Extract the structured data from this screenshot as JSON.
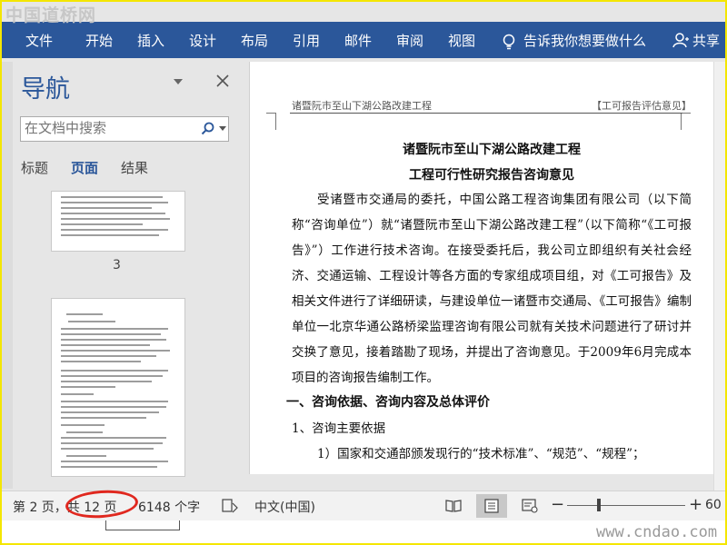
{
  "watermark_top": "中国道桥网",
  "watermark_bottom": "www.cndao.com",
  "ribbon": {
    "tabs": [
      "文件",
      "开始",
      "插入",
      "设计",
      "布局",
      "引用",
      "邮件",
      "审阅",
      "视图"
    ],
    "tell_me": "告诉我你想要做什么",
    "share": "共享"
  },
  "nav": {
    "title": "导航",
    "search_placeholder": "在文档中搜索",
    "tabs": [
      "标题",
      "页面",
      "结果"
    ],
    "active_tab": "页面",
    "page_label": "3"
  },
  "document": {
    "header_left": "诸暨阮市至山下湖公路改建工程",
    "header_right": "【工可报告评估意见】",
    "title1": "诸暨阮市至山下湖公路改建工程",
    "title2": "工程可行性研究报告咨询意见",
    "para1": "受诸暨市交通局的委托，中国公路工程咨询集团有限公司（以下简称“咨询单位”）就“诸暨阮市至山下湖公路改建工程”（以下简称“《工可报告》”）工作进行技术咨询。在接受委托后，我公司立即组织有关社会经济、交通运输、工程设计等各方面的专家组成项目组，对《工可报告》及相关文件进行了详细研读，与建设单位一诸暨市交通局、《工可报告》编制单位一北京华通公路桥梁监理咨询有限公司就有关技术问题进行了研讨并交换了意见，接着踏勘了现场，并提出了咨询意见。于2009年6月完成本项目的咨询报告编制工作。",
    "section1": "一、咨询依据、咨询内容及总体评价",
    "sub1": "1、咨询主要依据",
    "item1": "1）国家和交通部颁发现行的“技术标准”、“规范”、“规程”；"
  },
  "status": {
    "page_info": "第 2 页，共 12 页",
    "word_count": "6148 个字",
    "language": "中文(中国)",
    "zoom": "60"
  },
  "colors": {
    "ribbon": "#2b579a",
    "accent": "#2b579a",
    "annotation": "#e0281f",
    "frame": "#f4e600"
  }
}
